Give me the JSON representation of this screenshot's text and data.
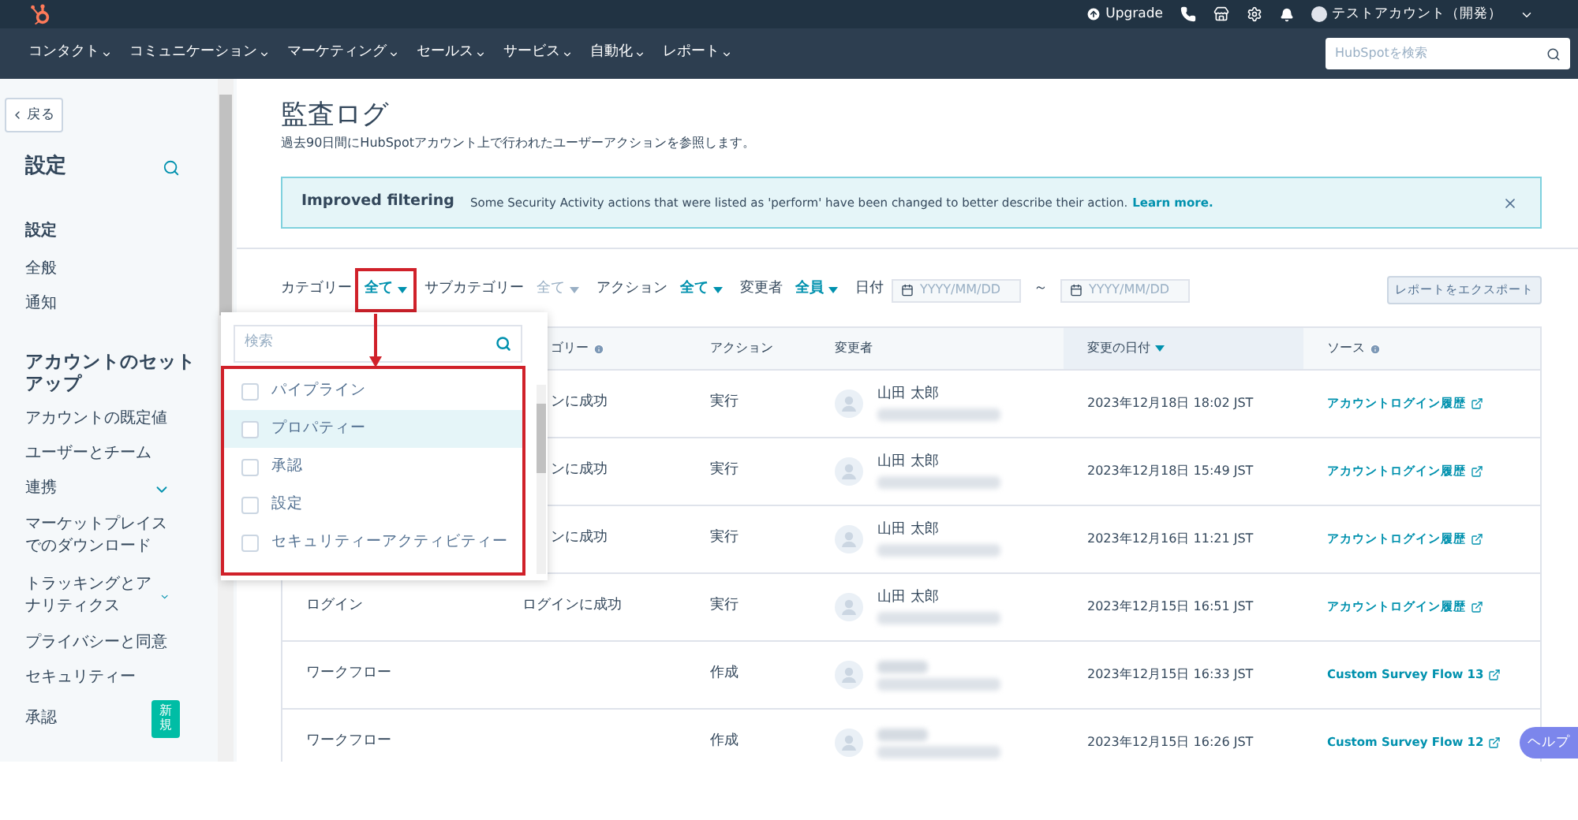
{
  "top_bar": {
    "upgrade": "Upgrade",
    "account": "テストアカウント（開発）"
  },
  "nav": {
    "items": [
      "コンタクト",
      "コミュニケーション",
      "マーケティング",
      "セールス",
      "サービス",
      "自動化",
      "レポート"
    ],
    "search_placeholder": "HubSpotを検索"
  },
  "sidebar": {
    "back": "戻る",
    "title": "設定",
    "sections": [
      {
        "heading": "設定",
        "items": [
          {
            "label": "全般",
            "expandable": false
          },
          {
            "label": "通知",
            "expandable": false
          }
        ]
      },
      {
        "heading": "アカウントのセットアップ",
        "items": [
          {
            "label": "アカウントの既定値",
            "expandable": false
          },
          {
            "label": "ユーザーとチーム",
            "expandable": false
          },
          {
            "label": "連携",
            "expandable": true
          },
          {
            "label": "マーケットプレイスでのダウンロード",
            "expandable": false
          },
          {
            "label": "トラッキングとアナリティクス",
            "expandable": true
          },
          {
            "label": "プライバシーと同意",
            "expandable": false
          },
          {
            "label": "セキュリティー",
            "expandable": false
          },
          {
            "label": "承認",
            "expandable": false,
            "badge": "新規"
          }
        ]
      }
    ]
  },
  "main": {
    "title": "監査ログ",
    "subtitle": "過去90日間にHubSpotアカウント上で行われたユーザーアクションを参照します。",
    "banner": {
      "title": "Improved filtering",
      "text": "Some Security Activity actions that were listed as 'perform' have been changed to better describe their action.",
      "link": "Learn more."
    },
    "filters": [
      {
        "label": "カテゴリー",
        "value": "全て",
        "disabled": false
      },
      {
        "label": "サブカテゴリー",
        "value": "全て",
        "disabled": true
      },
      {
        "label": "アクション",
        "value": "全て",
        "disabled": false
      },
      {
        "label": "変更者",
        "value": "全員",
        "disabled": false
      }
    ],
    "date_filter": {
      "label": "日付",
      "from_placeholder": "YYYY/MM/DD",
      "separator": "～",
      "to_placeholder": "YYYY/MM/DD"
    },
    "export_button": "レポートをエクスポート",
    "dropdown": {
      "search_placeholder": "検索",
      "options": [
        {
          "label": "パイプライン",
          "checked": false,
          "highlighted": false
        },
        {
          "label": "プロパティー",
          "checked": false,
          "highlighted": true
        },
        {
          "label": "承認",
          "checked": false,
          "highlighted": false
        },
        {
          "label": "設定",
          "checked": false,
          "highlighted": false
        },
        {
          "label": "セキュリティーアクティビティー",
          "checked": false,
          "highlighted": false
        }
      ]
    },
    "table": {
      "columns": [
        {
          "label": "ゴリー",
          "info": true,
          "sorted": false
        },
        {
          "label": "アクション",
          "info": false,
          "sorted": false
        },
        {
          "label": "変更者",
          "info": false,
          "sorted": false
        },
        {
          "label": "変更の日付",
          "info": false,
          "sorted": true
        },
        {
          "label": "ソース",
          "info": true,
          "sorted": false
        }
      ],
      "rows": [
        {
          "subcategory": "ンに成功",
          "action": "実行",
          "user": "山田 太郎",
          "date": "2023年12月18日 18:02 JST",
          "source": "アカウントログイン履歴"
        },
        {
          "subcategory": "ンに成功",
          "action": "実行",
          "user": "山田 太郎",
          "date": "2023年12月18日 15:49 JST",
          "source": "アカウントログイン履歴"
        },
        {
          "subcategory": "ンに成功",
          "action": "実行",
          "user": "山田 太郎",
          "date": "2023年12月16日 11:21 JST",
          "source": "アカウントログイン履歴"
        },
        {
          "category": "ログイン",
          "subcategory": "ログインに成功",
          "action": "実行",
          "user": "山田 太郎",
          "date": "2023年12月15日 16:51 JST",
          "source": "アカウントログイン履歴"
        },
        {
          "category": "ワークフロー",
          "action": "作成",
          "date": "2023年12月15日 16:33 JST",
          "source": "Custom Survey Flow 13"
        },
        {
          "category": "ワークフロー",
          "action": "作成",
          "date": "2023年12月15日 16:26 JST",
          "source": "Custom Survey Flow 12"
        }
      ]
    },
    "help_button": "ヘルプ"
  }
}
